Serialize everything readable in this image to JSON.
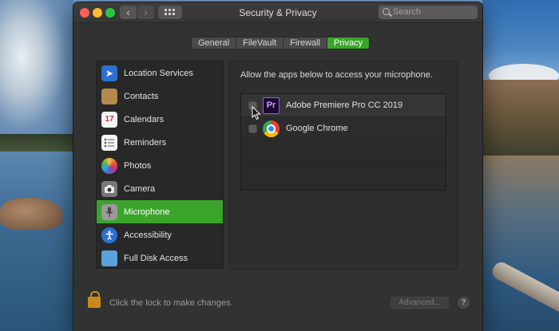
{
  "window": {
    "title": "Security & Privacy"
  },
  "search": {
    "placeholder": "Search"
  },
  "tabs": [
    {
      "label": "General",
      "active": false
    },
    {
      "label": "FileVault",
      "active": false
    },
    {
      "label": "Firewall",
      "active": false
    },
    {
      "label": "Privacy",
      "active": true
    }
  ],
  "services": [
    {
      "label": "Location Services",
      "icon": "location-arrow-icon"
    },
    {
      "label": "Contacts",
      "icon": "contacts-book-icon"
    },
    {
      "label": "Calendars",
      "icon": "calendar-icon",
      "icon_text": "17"
    },
    {
      "label": "Reminders",
      "icon": "reminders-list-icon"
    },
    {
      "label": "Photos",
      "icon": "photos-flower-icon"
    },
    {
      "label": "Camera",
      "icon": "camera-icon"
    },
    {
      "label": "Microphone",
      "icon": "microphone-icon",
      "selected": true
    },
    {
      "label": "Accessibility",
      "icon": "accessibility-icon"
    },
    {
      "label": "Full Disk Access",
      "icon": "folder-icon"
    }
  ],
  "panel": {
    "description": "Allow the apps below to access your microphone.",
    "apps": [
      {
        "name": "Adobe Premiere Pro CC 2019",
        "icon": "premiere-pro-icon",
        "icon_text": "Pr",
        "checked": false
      },
      {
        "name": "Google Chrome",
        "icon": "chrome-icon",
        "checked": false
      }
    ]
  },
  "footer": {
    "lock_text": "Click the lock to make changes.",
    "advanced_label": "Advanced...",
    "help_label": "?"
  },
  "colors": {
    "accent": "#3aa52a",
    "window_bg": "#323232"
  }
}
